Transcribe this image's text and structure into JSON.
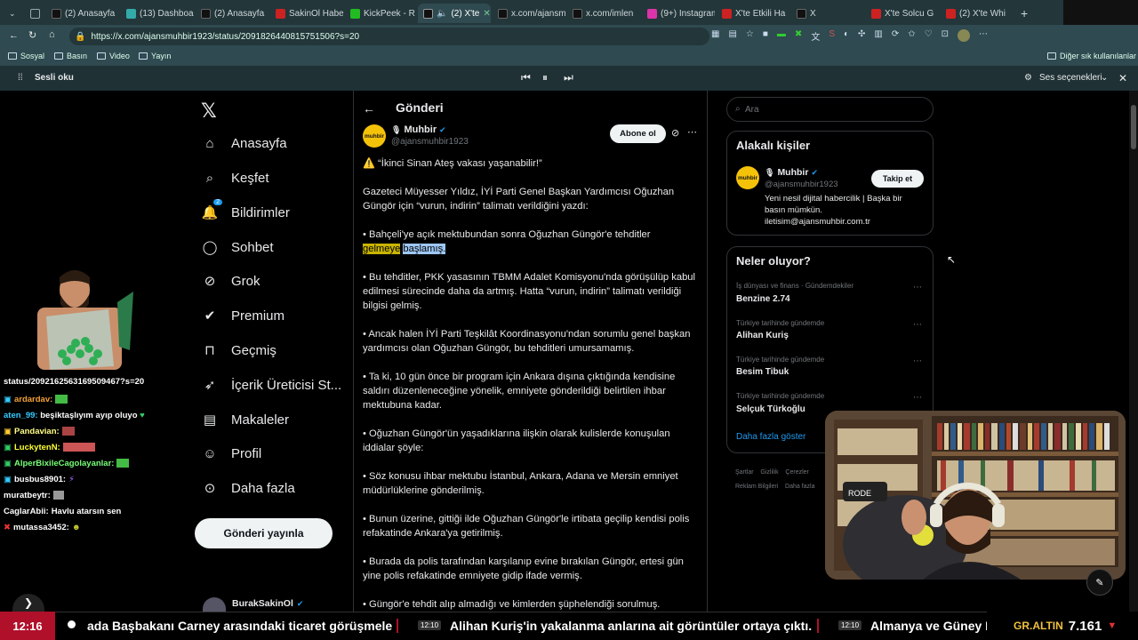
{
  "browser": {
    "tabs": [
      {
        "label": "",
        "color": "#9aa"
      },
      {
        "label": "(2) Anasayfa",
        "color": "#000"
      },
      {
        "label": "(13) Dashboard",
        "color": "#3aa"
      },
      {
        "label": "(2) Anasayfa",
        "color": "#000"
      },
      {
        "label": "SakinOl Haber",
        "color": "#c22"
      },
      {
        "label": "KickPeek - R",
        "color": "#2b2"
      },
      {
        "label": "(2) X'te",
        "color": "#000"
      },
      {
        "label": "x.com/ajansm",
        "color": "#000"
      },
      {
        "label": "x.com/imlen",
        "color": "#000"
      },
      {
        "label": "(9+) Instagram",
        "color": "#d3a"
      },
      {
        "label": "X'te Etkili Ha",
        "color": "#c22"
      },
      {
        "label": "X",
        "color": "#000"
      },
      {
        "label": "X'te Solcu G",
        "color": "#c22"
      },
      {
        "label": "(2) X'te Whi",
        "color": "#c22"
      }
    ],
    "url": "https://x.com/ajansmuhbir1923/status/2091826440815751506?s=20",
    "bookmarks": [
      "Sosyal",
      "Basın",
      "Video",
      "Yayın"
    ],
    "other_bookmarks": "Diğer sık kullanılanlar",
    "read_aloud": "Sesli oku",
    "voice_options": "Ses seçenekleri"
  },
  "nav": {
    "items": [
      "Anasayfa",
      "Keşfet",
      "Bildirimler",
      "Sohbet",
      "Grok",
      "Premium",
      "Geçmiş",
      "İçerik Üreticisi St...",
      "Makaleler",
      "Profil",
      "Daha fazla"
    ],
    "notif_count": "2",
    "post_button": "Gönderi yayınla",
    "account_name": "BurakSakinOl"
  },
  "post": {
    "header": "Gönderi",
    "author": "Muhbir",
    "handle": "@ajansmuhbir1923",
    "follow": "Abone ol",
    "avatar_text": "muhbir",
    "paragraphs": [
      "⚠️ “İkinci Sinan Ateş vakası yaşanabilir!”",
      "Gazeteci Müyesser Yıldız, İYİ Parti Genel Başkan Yardımcısı Oğuzhan Güngör için “vurun, indirin” talimatı verildiğini yazdı:",
      "• Bahçeli'ye açık mektubundan sonra Oğuzhan Güngör'e tehditler",
      "• Bu tehditler, PKK yasasının TBMM Adalet Komisyonu'nda görüşülüp kabul edilmesi sürecinde daha da artmış. Hatta “vurun, indirin” talimatı verildiği bilgisi gelmiş.",
      "• Ancak halen İYİ Parti Teşkilât Koordinasyonu'ndan sorumlu genel başkan yardımcısı olan Oğuzhan Güngör, bu tehditleri umursamamış.",
      "• Ta ki, 10 gün önce bir program için Ankara dışına çıktığında kendisine saldırı düzenleneceğine yönelik, emniyete gönderildiği belirtilen ihbar mektubuna kadar.",
      "• Oğuzhan Güngör'ün yaşadıklarına ilişkin olarak kulislerde konuşulan iddialar şöyle:",
      "• Söz konusu ihbar mektubu İstanbul, Ankara, Adana ve Mersin emniyet müdürlüklerine gönderilmiş.",
      "• Bunun üzerine, gittiği ilde Oğuzhan Güngör'le irtibata geçilip kendisi polis refakatinde Ankara'ya getirilmiş.",
      "• Burada da polis tarafından karşılanıp evine bırakılan Güngör, ertesi gün yine polis refakatinde emniyete gidip ifade vermiş.",
      "• Güngör'e tehdit alıp almadığı ve kimlerden şüphelendiği sorulmuş."
    ],
    "highlight_1": "gelmeye",
    "highlight_2": "başlamış."
  },
  "sidebar": {
    "search_placeholder": "Ara",
    "related_title": "Alakalı kişiler",
    "related_name": "Muhbir",
    "related_handle": "@ajansmuhbir1923",
    "related_follow": "Takip et",
    "related_bio": "Yeni nesil dijital habercilik | Başka bir basın mümkün. iletisim@ajansmuhbir.com.tr",
    "trends_title": "Neler oluyor?",
    "trends": [
      {
        "context": "İş dünyası ve finans · Gündemdekiler",
        "name": "Benzine 2.74"
      },
      {
        "context": "Türkiye tarihinde gündemde",
        "name": "Alihan Kuriş"
      },
      {
        "context": "Türkiye tarihinde gündemde",
        "name": "Besim Tibuk"
      },
      {
        "context": "Türkiye tarihinde gündemde",
        "name": "Selçuk Türkoğlu"
      }
    ],
    "show_more": "Daha fazla göster",
    "footer": [
      "Şartlar",
      "Gizlilik",
      "Çerezler",
      "Reklam Bilgileri",
      "Daha fazla"
    ]
  },
  "stream": {
    "chat_url": "status/2092162563169509467?s=20",
    "chat": [
      {
        "user": "ardardav:",
        "msg": ""
      },
      {
        "user": "aten_99:",
        "msg": "beşiktaşlıyım ayıp oluyo"
      },
      {
        "user": "Pandavian:",
        "msg": ""
      },
      {
        "user": "LuckytenN:",
        "msg": ""
      },
      {
        "user": "AlperBixileCagolayanlar:",
        "msg": ""
      },
      {
        "user": "busbus8901:",
        "msg": ""
      },
      {
        "user": "muratbeytr:",
        "msg": ""
      },
      {
        "user": "CaglarAbii:",
        "msg": "Havlu atarsın sen"
      },
      {
        "user": "mutassa3452:",
        "msg": ""
      }
    ],
    "clock": "12:16",
    "ticker": [
      {
        "time": "",
        "text": "ada Başbakanı Carney arasındaki ticaret görüşmele"
      },
      {
        "time": "12:10",
        "text": "Alihan Kuriş'in yakalanma anlarına ait görüntüler ortaya çıktı."
      },
      {
        "time": "12:10",
        "text": "Almanya ve Güney K"
      }
    ],
    "gold_label": "GR.ALTIN",
    "gold_value": "7.161",
    "gold_trend": "▼",
    "colors": {
      "accent": "#b0102a",
      "gold_down": "#e0303a",
      "verified": "#1d9bf0"
    }
  }
}
